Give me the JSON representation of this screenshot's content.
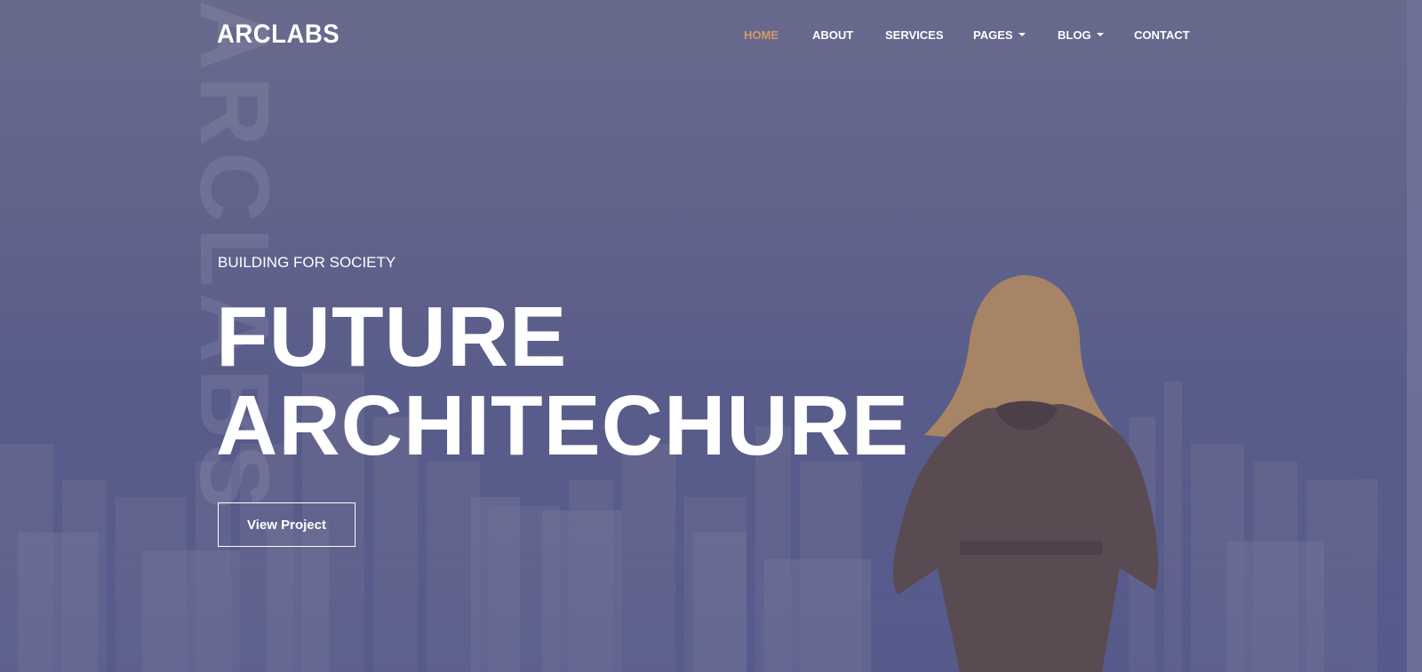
{
  "brand": {
    "logo": "ARCLABS",
    "watermark": "ARCLABS"
  },
  "nav": {
    "items": [
      {
        "label": "HOME",
        "active": true,
        "dropdown": false
      },
      {
        "label": "ABOUT",
        "active": false,
        "dropdown": false
      },
      {
        "label": "SERVICES",
        "active": false,
        "dropdown": false
      },
      {
        "label": "PAGES",
        "active": false,
        "dropdown": true
      },
      {
        "label": "BLOG",
        "active": false,
        "dropdown": true
      },
      {
        "label": "CONTACT",
        "active": false,
        "dropdown": false
      }
    ]
  },
  "hero": {
    "eyebrow": "BUILDING FOR SOCIETY",
    "headline_line1": "FUTURE",
    "headline_line2": "ARCHITECHURE",
    "cta_label": "View Project"
  },
  "colors": {
    "accent": "#d39a63",
    "overlay": "#5f628a",
    "text": "#ffffff"
  }
}
